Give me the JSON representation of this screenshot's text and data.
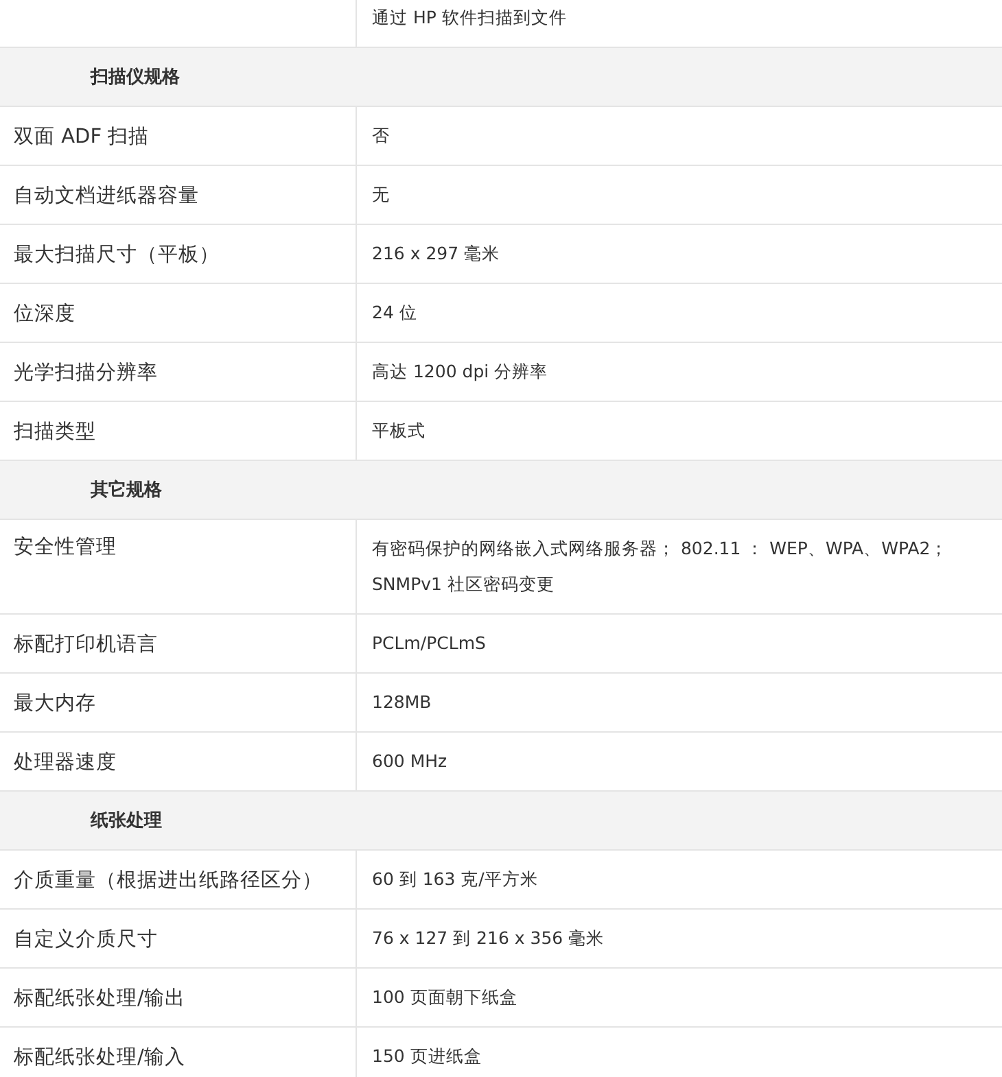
{
  "rows": [
    {
      "kind": "spec",
      "value": "通过 HP 软件扫描到文件"
    },
    {
      "kind": "section",
      "label": "扫描仪规格"
    },
    {
      "kind": "spec",
      "label": "双面 ADF 扫描",
      "value": "否"
    },
    {
      "kind": "spec",
      "label": "自动文档进纸器容量",
      "value": "无"
    },
    {
      "kind": "spec",
      "label": "最大扫描尺寸（平板）",
      "value": "216 x 297 毫米"
    },
    {
      "kind": "spec",
      "label": "位深度",
      "value": "24 位"
    },
    {
      "kind": "spec",
      "label": "光学扫描分辨率",
      "value": "高达 1200 dpi 分辨率"
    },
    {
      "kind": "spec",
      "label": "扫描类型",
      "value": "平板式"
    },
    {
      "kind": "section",
      "label": "其它规格"
    },
    {
      "kind": "spec",
      "label": "安全性管理",
      "value": "有密码保护的网络嵌入式网络服务器； 802.11 ： WEP、WPA、WPA2； SNMPv1 社区密码变更"
    },
    {
      "kind": "spec",
      "label": "标配打印机语言",
      "value": "PCLm/PCLmS"
    },
    {
      "kind": "spec",
      "label": "最大内存",
      "value": "128MB"
    },
    {
      "kind": "spec",
      "label": "处理器速度",
      "value": "600 MHz"
    },
    {
      "kind": "section",
      "label": "纸张处理"
    },
    {
      "kind": "spec",
      "label": "介质重量（根据进出纸路径区分）",
      "value": "60 到 163 克/平方米"
    },
    {
      "kind": "spec",
      "label": "自定义介质尺寸",
      "value": "76 x 127 到 216 x 356 毫米"
    },
    {
      "kind": "spec",
      "label": "标配纸张处理/输出",
      "value": "100 页面朝下纸盒"
    },
    {
      "kind": "spec",
      "label": "标配纸张处理/输入",
      "value": "150 页进纸盒"
    }
  ]
}
